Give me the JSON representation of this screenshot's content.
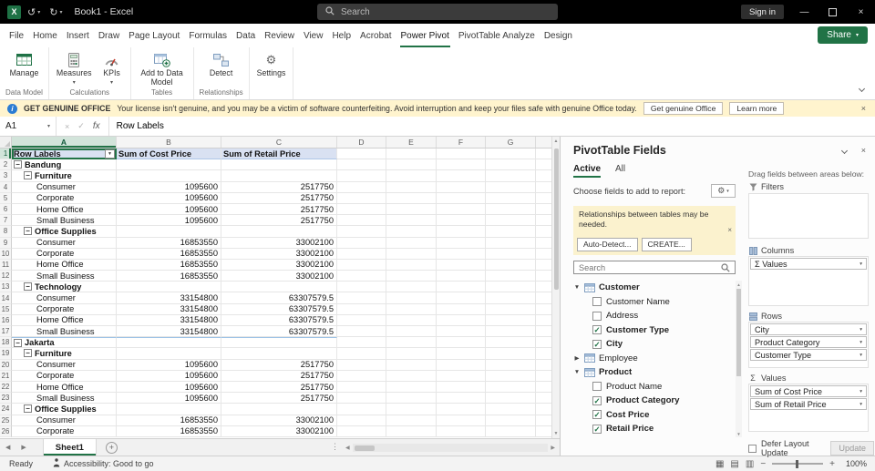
{
  "colors": {
    "accent_green": "#217346",
    "titlebar_bg": "#000000",
    "warning_bg": "#FFF4CE",
    "pivot_header_fill": "#D9E1F2"
  },
  "icons": {
    "close": "×",
    "check": "✓",
    "caret": "▾",
    "undo": "↺",
    "redo": "↻",
    "minus": "−",
    "plus": "+",
    "gear": "⚙",
    "sigma": "Σ",
    "left_tri": "◀",
    "right_tri": "▶",
    "up_tri": "▲",
    "down_tri": "▼",
    "expand_open": "▼",
    "expand_closed": "▶",
    "dots_v": "⋮",
    "dash": "—",
    "info": "i",
    "excel_x": "X",
    "collapse_minus": "−",
    "view_normal": "▦",
    "view_layout": "▤",
    "view_break": "▥"
  },
  "titlebar": {
    "doc_title": "Book1 - Excel",
    "search_placeholder": "Search",
    "sign_in_label": "Sign in"
  },
  "ribbon": {
    "tabs": [
      "File",
      "Home",
      "Insert",
      "Draw",
      "Page Layout",
      "Formulas",
      "Data",
      "Review",
      "View",
      "Help",
      "Acrobat",
      "Power Pivot",
      "PivotTable Analyze",
      "Design"
    ],
    "active_tab": "Power Pivot",
    "share_label": "Share",
    "groups": [
      {
        "label": "Data Model",
        "buttons": [
          {
            "label": "Manage",
            "icon": "manage-table-icon",
            "dropdown": false
          }
        ]
      },
      {
        "label": "Calculations",
        "buttons": [
          {
            "label": "Measures",
            "icon": "measures-icon",
            "dropdown": true
          },
          {
            "label": "KPIs",
            "icon": "kpi-icon",
            "dropdown": true
          }
        ]
      },
      {
        "label": "Tables",
        "buttons": [
          {
            "label": "Add to Data Model",
            "icon": "add-to-data-model-icon",
            "dropdown": false
          }
        ]
      },
      {
        "label": "Relationships",
        "buttons": [
          {
            "label": "Detect",
            "icon": "detect-relationships-icon",
            "dropdown": false
          }
        ]
      },
      {
        "label": "",
        "buttons": [
          {
            "label": "Settings",
            "icon": "settings-gear-icon",
            "dropdown": false
          }
        ]
      }
    ]
  },
  "warning_bar": {
    "badge": "GET GENUINE OFFICE",
    "message": "Your license isn't genuine, and you may be a victim of software counterfeiting. Avoid interruption and keep your files safe with genuine Office today.",
    "get_button": "Get genuine Office",
    "learn_button": "Learn more"
  },
  "formula_bar": {
    "name_box": "A1",
    "content": "Row Labels",
    "fx": "fx"
  },
  "grid": {
    "column_letters": [
      "A",
      "B",
      "C",
      "D",
      "E",
      "F",
      "G"
    ],
    "selected_cell": "A1",
    "header_row_number": "1",
    "header_row": {
      "a": "Row Labels",
      "b": "Sum of Cost Price",
      "c": "Sum of Retail Price"
    },
    "rows": [
      {
        "n": 2,
        "label": "Bandung",
        "level": 0,
        "group": true
      },
      {
        "n": 3,
        "label": "Furniture",
        "level": 1,
        "group": true
      },
      {
        "n": 4,
        "label": "Consumer",
        "level": 2,
        "cost": "1095600",
        "retail": "2517750"
      },
      {
        "n": 5,
        "label": "Corporate",
        "level": 2,
        "cost": "1095600",
        "retail": "2517750"
      },
      {
        "n": 6,
        "label": "Home Office",
        "level": 2,
        "cost": "1095600",
        "retail": "2517750"
      },
      {
        "n": 7,
        "label": "Small Business",
        "level": 2,
        "cost": "1095600",
        "retail": "2517750"
      },
      {
        "n": 8,
        "label": "Office Supplies",
        "level": 1,
        "group": true
      },
      {
        "n": 9,
        "label": "Consumer",
        "level": 2,
        "cost": "16853550",
        "retail": "33002100"
      },
      {
        "n": 10,
        "label": "Corporate",
        "level": 2,
        "cost": "16853550",
        "retail": "33002100"
      },
      {
        "n": 11,
        "label": "Home Office",
        "level": 2,
        "cost": "16853550",
        "retail": "33002100"
      },
      {
        "n": 12,
        "label": "Small Business",
        "level": 2,
        "cost": "16853550",
        "retail": "33002100"
      },
      {
        "n": 13,
        "label": "Technology",
        "level": 1,
        "group": true
      },
      {
        "n": 14,
        "label": "Consumer",
        "level": 2,
        "cost": "33154800",
        "retail": "63307579.5"
      },
      {
        "n": 15,
        "label": "Corporate",
        "level": 2,
        "cost": "33154800",
        "retail": "63307579.5"
      },
      {
        "n": 16,
        "label": "Home Office",
        "level": 2,
        "cost": "33154800",
        "retail": "63307579.5"
      },
      {
        "n": 17,
        "label": "Small Business",
        "level": 2,
        "cost": "33154800",
        "retail": "63307579.5"
      },
      {
        "n": 18,
        "label": "Jakarta",
        "level": 0,
        "group": true,
        "sep": true
      },
      {
        "n": 19,
        "label": "Furniture",
        "level": 1,
        "group": true
      },
      {
        "n": 20,
        "label": "Consumer",
        "level": 2,
        "cost": "1095600",
        "retail": "2517750"
      },
      {
        "n": 21,
        "label": "Corporate",
        "level": 2,
        "cost": "1095600",
        "retail": "2517750"
      },
      {
        "n": 22,
        "label": "Home Office",
        "level": 2,
        "cost": "1095600",
        "retail": "2517750"
      },
      {
        "n": 23,
        "label": "Small Business",
        "level": 2,
        "cost": "1095600",
        "retail": "2517750"
      },
      {
        "n": 24,
        "label": "Office Supplies",
        "level": 1,
        "group": true
      },
      {
        "n": 25,
        "label": "Consumer",
        "level": 2,
        "cost": "16853550",
        "retail": "33002100"
      },
      {
        "n": 26,
        "label": "Corporate",
        "level": 2,
        "cost": "16853550",
        "retail": "33002100"
      }
    ]
  },
  "sheet_bar": {
    "sheet": "Sheet1"
  },
  "status_bar": {
    "ready": "Ready",
    "accessibility": "Accessibility: Good to go",
    "zoom": "100%"
  },
  "pane": {
    "title": "PivotTable Fields",
    "tab_active": "Active",
    "tab_all": "All",
    "choose_label": "Choose fields to add to report:",
    "notice_text": "Relationships between tables may be needed.",
    "auto_detect_label": "Auto-Detect...",
    "create_label": "CREATE...",
    "search_placeholder": "Search",
    "tables": [
      {
        "name": "Customer",
        "expanded": true,
        "bold": true,
        "fields": [
          {
            "name": "Customer Name",
            "checked": false
          },
          {
            "name": "Address",
            "checked": false
          },
          {
            "name": "Customer Type",
            "checked": true
          },
          {
            "name": "City",
            "checked": true
          }
        ]
      },
      {
        "name": "Employee",
        "expanded": false,
        "bold": false,
        "fields": []
      },
      {
        "name": "Product",
        "expanded": true,
        "bold": true,
        "fields": [
          {
            "name": "Product Name",
            "checked": false
          },
          {
            "name": "Product Category",
            "checked": true
          },
          {
            "name": "Cost Price",
            "checked": true
          },
          {
            "name": "Retail Price",
            "checked": true
          }
        ]
      }
    ],
    "drag_label": "Drag fields between areas below:",
    "areas": [
      {
        "label": "Filters",
        "items": []
      },
      {
        "label": "Columns",
        "items": [
          "Σ Values"
        ]
      },
      {
        "label": "Rows",
        "items": [
          "City",
          "Product Category",
          "Customer Type"
        ]
      },
      {
        "label": "Values",
        "items": [
          "Sum of Cost Price",
          "Sum of Retail Price"
        ]
      }
    ],
    "defer_label": "Defer Layout Update",
    "update_label": "Update"
  }
}
